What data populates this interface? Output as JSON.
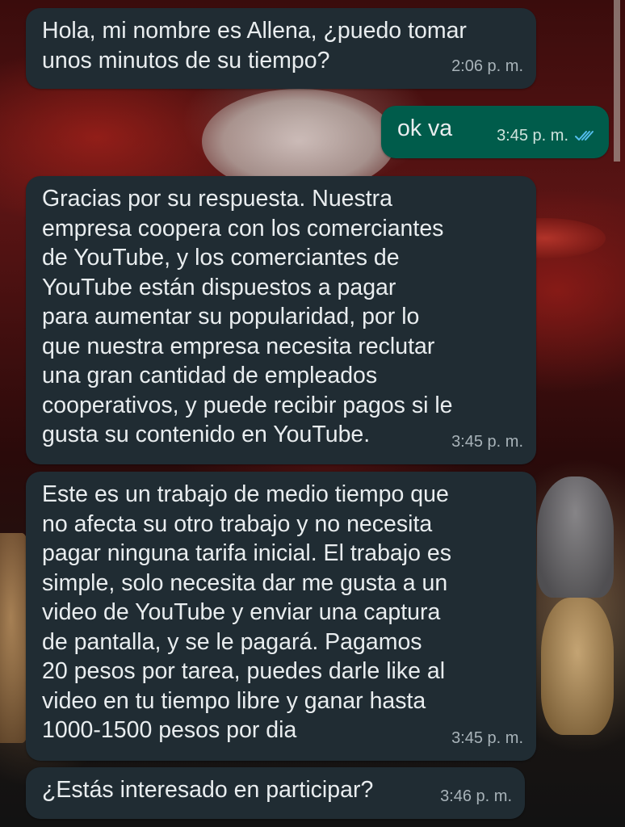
{
  "colors": {
    "incoming_bubble": "#202c33",
    "outgoing_bubble": "#005c4b",
    "text": "#e9edef",
    "timestamp": "#a8b3b9",
    "read_ticks": "#53bdeb"
  },
  "messages": [
    {
      "direction": "incoming",
      "text": "Hola, mi nombre es Allena, ¿puedo tomar\nunos minutos de su tiempo?",
      "time": "2:06 p. m."
    },
    {
      "direction": "outgoing",
      "text": "ok va",
      "time": "3:45 p. m.",
      "status_icon": "double-check-read-icon"
    },
    {
      "direction": "incoming",
      "text": "Gracias por su respuesta. Nuestra\nempresa coopera con los comerciantes\nde YouTube, y los comerciantes de\nYouTube están dispuestos a pagar\npara aumentar su popularidad, por lo\nque nuestra empresa necesita reclutar\nuna gran cantidad de empleados\ncooperativos, y puede recibir pagos si le\ngusta su contenido en YouTube.",
      "time": "3:45 p. m."
    },
    {
      "direction": "incoming",
      "text": "Este es un trabajo de medio tiempo que\nno afecta su otro trabajo y no necesita\npagar ninguna tarifa inicial. El trabajo es\nsimple, solo necesita dar me gusta a un\nvideo de YouTube y enviar una captura\nde pantalla, y se le pagará. Pagamos\n20 pesos por tarea, puedes darle like al\nvideo en tu tiempo libre y ganar hasta\n1000-1500 pesos por dia",
      "time": "3:45 p. m."
    },
    {
      "direction": "incoming",
      "text": "¿Estás interesado en participar?",
      "time": "3:46 p. m."
    }
  ]
}
